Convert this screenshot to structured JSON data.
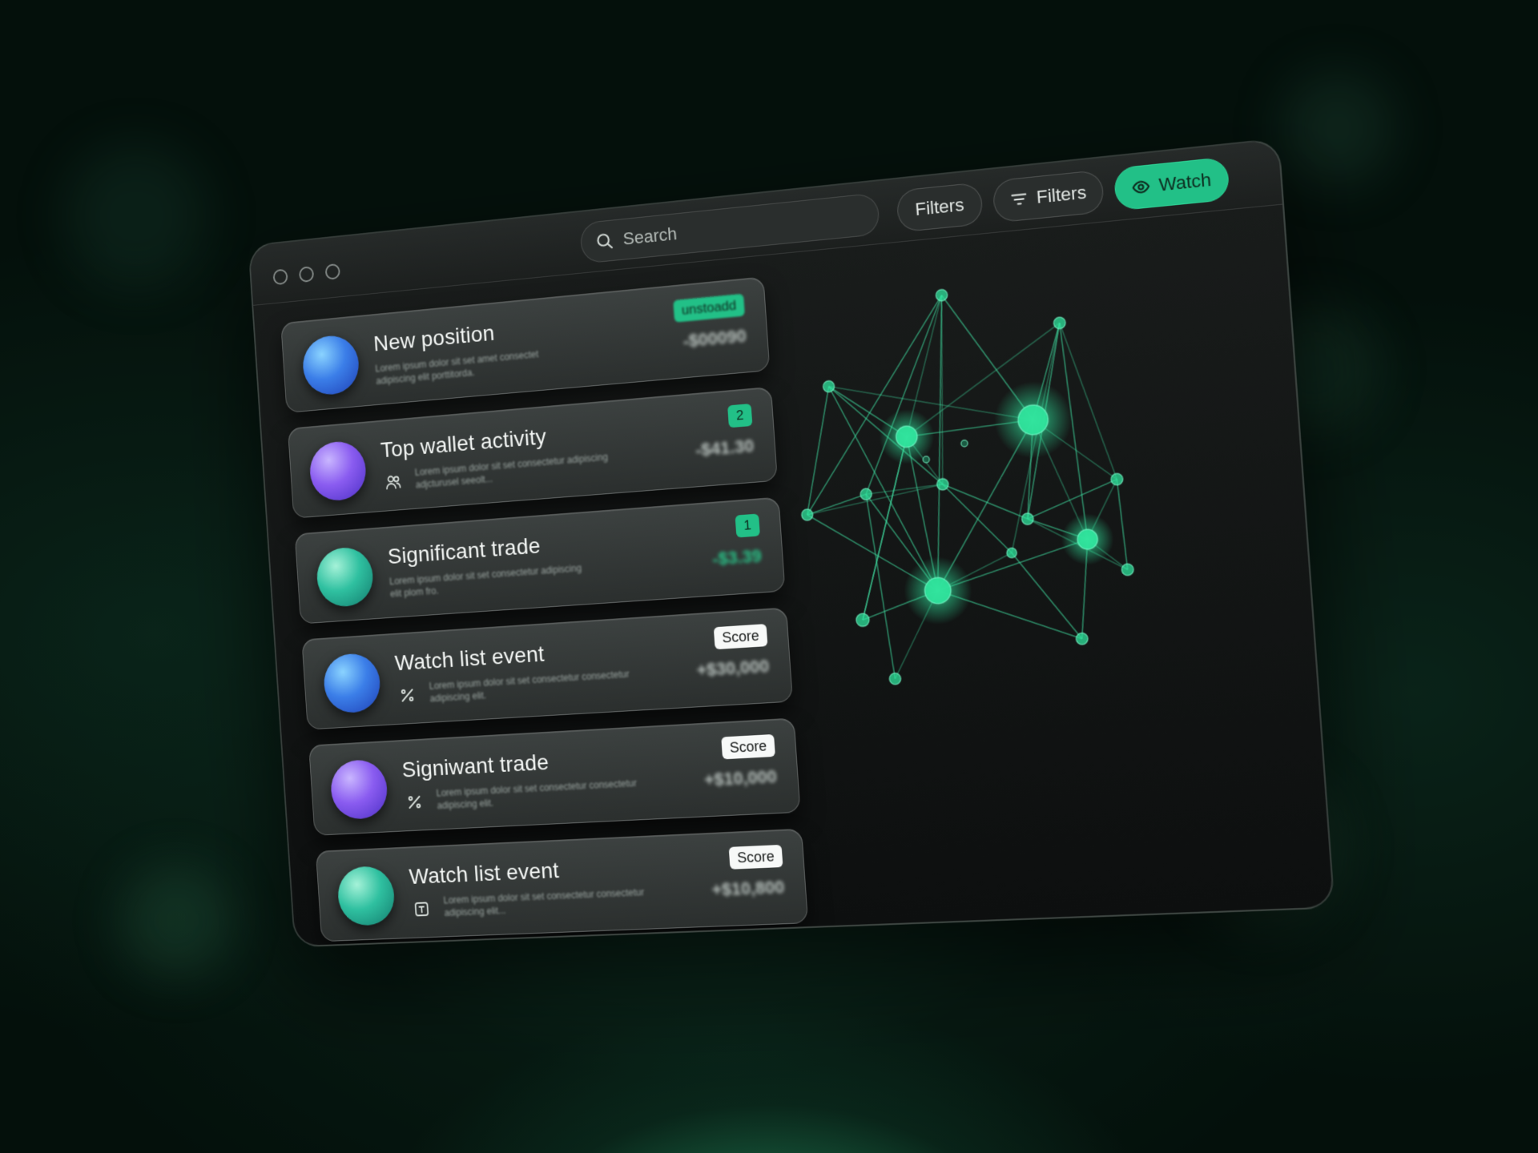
{
  "window": {
    "traffic_lights": [
      "close",
      "minimize",
      "zoom"
    ]
  },
  "toolbar": {
    "search_placeholder": "Search",
    "filters_1_label": "Filters",
    "filters_2_label": "Filters",
    "watch_label": "Watch"
  },
  "colors": {
    "accent": "#22c087",
    "node": "#2fe39c",
    "card": "#34393",
    "background": "#04100b"
  },
  "cards": [
    {
      "title": "New position",
      "description": "Lorem ipsum dolor sit set amet consectet adipiscing elit porttitorda.",
      "badge": "unstoadd",
      "badge_style": "green",
      "amount": "-$00090",
      "amount_style": "grey",
      "orb": "blue",
      "icon": ""
    },
    {
      "title": "Top wallet activity",
      "description": "Lorem ipsum dolor sit set consectetur adipiscing adjcturusel seeolt...",
      "badge": "2",
      "badge_style": "green",
      "amount": "-$41.30",
      "amount_style": "grey",
      "orb": "purple",
      "icon": "users-icon"
    },
    {
      "title": "Significant trade",
      "description": "Lorem ipsum dolor sit set consectetur adipiscing elit plom fro.",
      "badge": "1",
      "badge_style": "green",
      "amount": "-$3.39",
      "amount_style": "green",
      "orb": "teal",
      "icon": ""
    },
    {
      "title": "Watch list event",
      "description": "Lorem ipsum dolor sit set consectetur consectetur adipiscing elit.",
      "badge": "Score",
      "badge_style": "white",
      "amount": "+$30,000",
      "amount_style": "grey",
      "orb": "blue",
      "icon": "percent-icon"
    },
    {
      "title": "Signiwant trade",
      "description": "Lorem ipsum dolor sit set consectetur consectetur adipiscing elit.",
      "badge": "Score",
      "badge_style": "white",
      "amount": "+$10,000",
      "amount_style": "grey",
      "orb": "purple",
      "icon": "percent-icon"
    },
    {
      "title": "Watch list event",
      "description": "Lorem ipsum dolor sit set consectetur consectetur adipiscing elit...",
      "badge": "Score",
      "badge_style": "white",
      "amount": "+$10,800",
      "amount_style": "grey",
      "orb": "teal",
      "icon": "text-box-icon"
    }
  ]
}
